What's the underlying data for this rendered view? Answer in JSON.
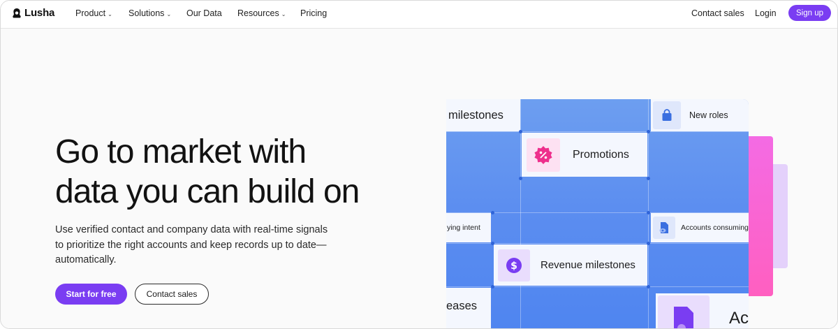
{
  "brand": {
    "name": "Lusha"
  },
  "nav": {
    "items": [
      {
        "label": "Product",
        "has_dropdown": true
      },
      {
        "label": "Solutions",
        "has_dropdown": true
      },
      {
        "label": "Our Data",
        "has_dropdown": false
      },
      {
        "label": "Resources",
        "has_dropdown": true
      },
      {
        "label": "Pricing",
        "has_dropdown": false
      }
    ],
    "contact_sales": "Contact sales",
    "login": "Login",
    "signup": "Sign up"
  },
  "hero": {
    "headline_line1": "Go to market with",
    "headline_line2": "data you can build on",
    "subtext": "Use verified contact and company data with real-time signals to prioritize the right accounts and keep records up to date—automatically.",
    "cta_primary": "Start for free",
    "cta_secondary": "Contact sales"
  },
  "visual": {
    "cards": {
      "milestones": "milestones",
      "new_roles": "New roles",
      "promotions": "Promotions",
      "buying_intent": "ying intent",
      "accounts_consuming": "Accounts consuming",
      "revenue_milestones": "Revenue milestones",
      "releases": "eases",
      "partial": "Ac"
    },
    "icons": {
      "new_roles": "shopping-bag-icon",
      "promotions": "percent-badge-icon",
      "accounts_consuming": "document-eye-icon",
      "revenue_milestones": "dollar-coin-icon",
      "partial": "document-icon"
    },
    "colors": {
      "accent": "#7a3df2",
      "panel_blue": "#5b8df0",
      "pink": "#ff5fc0",
      "lavender": "#e4d1fb"
    }
  }
}
